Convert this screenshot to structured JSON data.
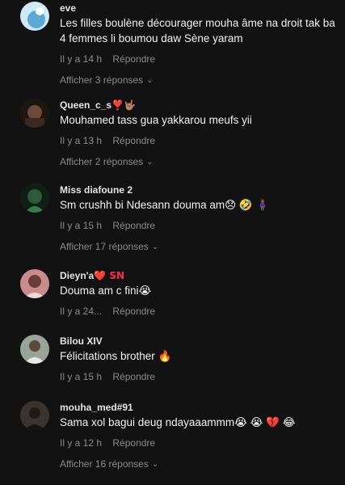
{
  "comments": [
    {
      "username": "eve",
      "text": "Les filles boulène décourager mouha âme na droit tak ba 4 femmes li boumou daw Sène yaram",
      "time": "Il y a 14 h",
      "reply": "Répondre",
      "more": "Afficher 3 réponses",
      "avatar_color": "#5aa9d6"
    },
    {
      "username": "Queen_c_s",
      "username_suffix": "❣️🤟🏽",
      "text": "Mouhamed tass gua yakkarou meufs yii",
      "time": "Il y a 13 h",
      "reply": "Répondre",
      "more": "Afficher 2 réponses",
      "avatar_color": "#3b2a22"
    },
    {
      "username": "Miss diafoune 2",
      "text": "Sm crushh bi Ndesann douma am😞 🤣 🧍🏾‍♀️",
      "time": "Il y a 15 h",
      "reply": "Répondre",
      "more": "Afficher 17 réponses",
      "avatar_color": "#2c5a3a"
    },
    {
      "username": "Dieyn'a",
      "username_suffix": "❤️ SN",
      "text": "Douma am c fini😭",
      "time": "Il y a 24...",
      "reply": "Répondre",
      "avatar_color": "#6a3b3b"
    },
    {
      "username": "Bilou XIV",
      "text": "Félicitations brother 🔥",
      "time": "Il y a 15 h",
      "reply": "Répondre",
      "avatar_color": "#5b4a3c"
    },
    {
      "username": "mouha_med#91",
      "text": "Sama xol bagui deug ndayaaammm😭 😭 💔 😂",
      "time": "Il y a 12 h",
      "reply": "Répondre",
      "more": "Afficher 16 réponses",
      "avatar_color": "#2a2624"
    }
  ],
  "chevron_icon": "chevron-down-icon"
}
